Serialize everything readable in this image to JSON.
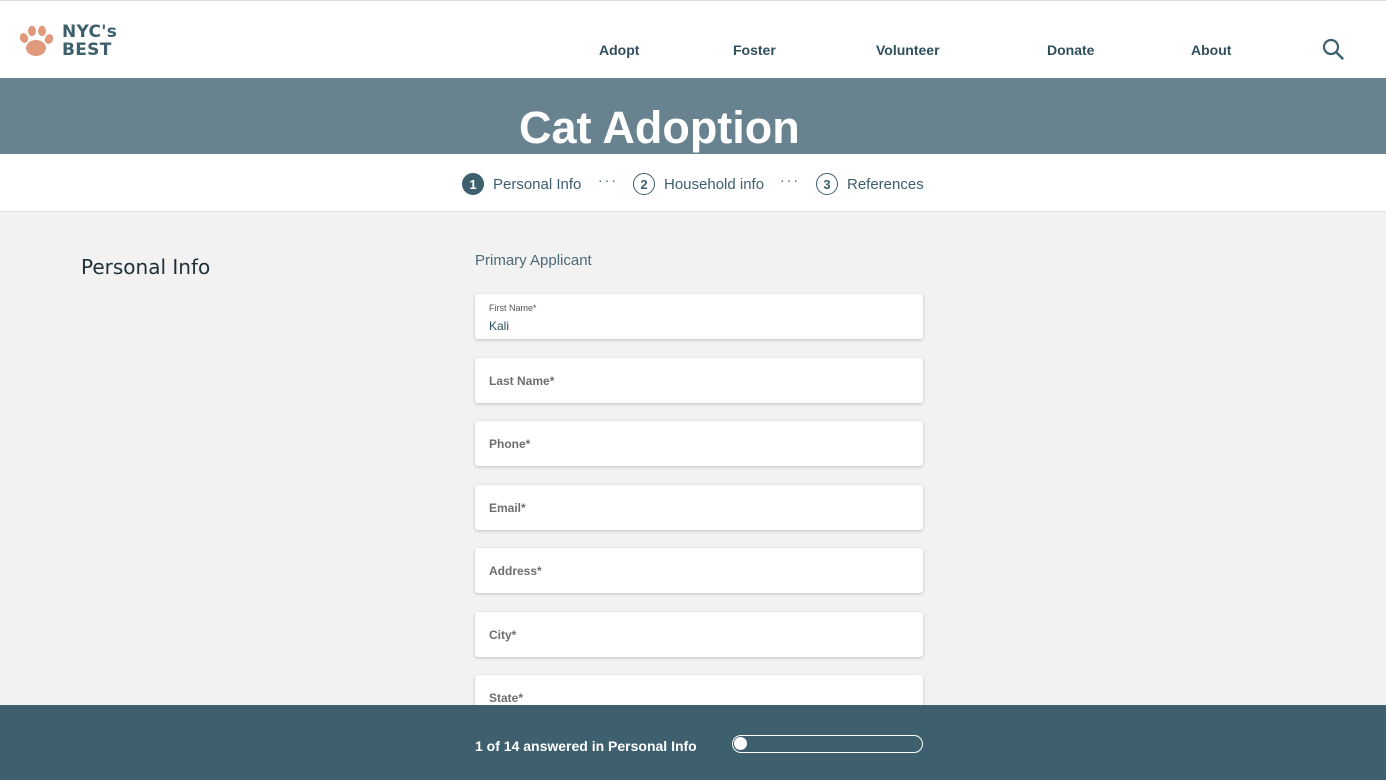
{
  "logo": {
    "line1": "NYC's",
    "line2": "BEST",
    "icon": "paw-icon",
    "color": "#e0997a"
  },
  "nav": {
    "items": [
      "Adopt",
      "Foster",
      "Volunteer",
      "Donate",
      "About"
    ],
    "search_icon": "search-icon"
  },
  "banner": {
    "title": "Cat Adoption"
  },
  "stepper": {
    "steps": [
      {
        "num": "1",
        "label": "Personal Info"
      },
      {
        "num": "2",
        "label": "Household info"
      },
      {
        "num": "3",
        "label": "References"
      }
    ],
    "separator": "···"
  },
  "form": {
    "section_title": "Personal Info",
    "subtitle": "Primary Applicant",
    "fields": [
      {
        "label": "First Name*",
        "value": "Kali"
      },
      {
        "label": "Last Name*",
        "value": ""
      },
      {
        "label": "Phone*",
        "value": ""
      },
      {
        "label": "Email*",
        "value": ""
      },
      {
        "label": "Address*",
        "value": ""
      },
      {
        "label": "City*",
        "value": ""
      },
      {
        "label": "State*",
        "value": ""
      }
    ]
  },
  "footer": {
    "status": "1 of 14 answered in Personal Info",
    "progress": 0.07
  },
  "colors": {
    "primary": "#3d5f6e",
    "banner": "#68838f",
    "background": "#f2f2f2",
    "accent": "#e0997a"
  }
}
